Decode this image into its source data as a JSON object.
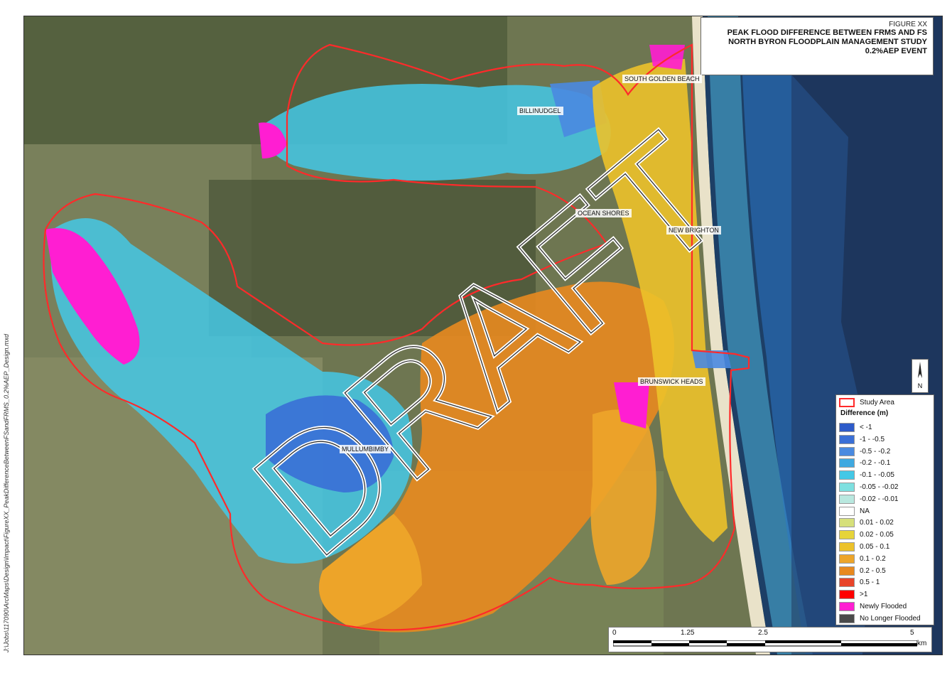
{
  "title": {
    "figure": "FIGURE XX",
    "line1": "PEAK FLOOD DIFFERENCE BETWEEN FRMS AND FS",
    "line2": "NORTH BYRON FLOODPLAIN MANAGEMENT STUDY",
    "line3": "0.2%AEP EVENT"
  },
  "watermark": "DRAFT",
  "file_path": "J:\\Jobs\\117090\\ArcMaps\\Design\\Impact\\FigureXX_PeakDifferenceBetweenFSandFRMS_0.2%AEP_Design.mxd",
  "places": [
    "SOUTH GOLDEN BEACH",
    "BILLINUDGEL",
    "OCEAN SHORES",
    "NEW BRIGHTON",
    "BRUNSWICK HEADS",
    "MULLUMBIMBY"
  ],
  "north_arrow": "N",
  "legend": {
    "study_area": "Study Area",
    "heading": "Difference (m)",
    "items": [
      {
        "label": "< -1",
        "color": "#2e5bc9"
      },
      {
        "label": "-1 - -0.5",
        "color": "#3a6fd6"
      },
      {
        "label": "-0.5 - -0.2",
        "color": "#4a8ae0"
      },
      {
        "label": "-0.2 - -0.1",
        "color": "#3fa9e0"
      },
      {
        "label": "-0.1 - -0.05",
        "color": "#44c8e6"
      },
      {
        "label": "-0.05 - -0.02",
        "color": "#7ee0e0"
      },
      {
        "label": "-0.02 - -0.01",
        "color": "#b9e8df"
      },
      {
        "label": "NA",
        "color": "#ffffff"
      },
      {
        "label": "0.01 - 0.02",
        "color": "#d6e07a"
      },
      {
        "label": "0.02 - 0.05",
        "color": "#e6d43a"
      },
      {
        "label": "0.05 - 0.1",
        "color": "#ecc22a"
      },
      {
        "label": "0.1 - 0.2",
        "color": "#eda52a"
      },
      {
        "label": "0.2 - 0.5",
        "color": "#e8891f"
      },
      {
        "label": "0.5 - 1",
        "color": "#e8452a"
      },
      {
        "label": ">1",
        "color": "#ff0000"
      },
      {
        "label": "Newly Flooded",
        "color": "#ff1ed2"
      },
      {
        "label": "No Longer Flooded",
        "color": "#4a4a4a"
      }
    ],
    "study_area_color": "#ff2a2a"
  },
  "scale_bar": {
    "ticks": [
      "0",
      "1.25",
      "2.5",
      "5"
    ],
    "unit": "km"
  }
}
